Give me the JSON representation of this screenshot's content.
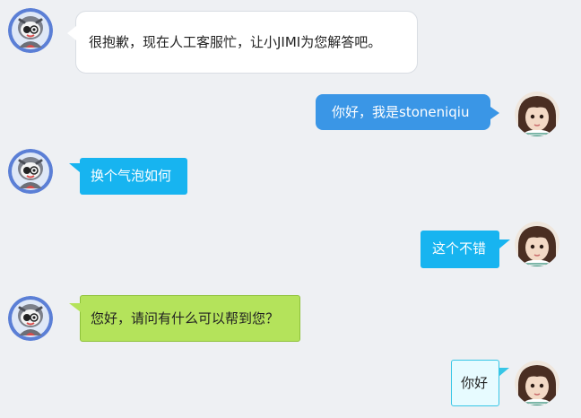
{
  "messages": [
    {
      "sender": "bot",
      "text": "很抱歉，现在人工客服忙，让小JIMI为您解答吧。",
      "bubble_color": "#ffffff"
    },
    {
      "sender": "user",
      "text": "你好，我是stoneniqiu",
      "bubble_color": "#3a96e6"
    },
    {
      "sender": "bot",
      "text": "换个气泡如何",
      "bubble_color": "#17b4f0"
    },
    {
      "sender": "user",
      "text": "这个不错",
      "bubble_color": "#17b4f0"
    },
    {
      "sender": "bot",
      "text": "您好，请问有什么可以帮到您？",
      "bubble_color": "#b4e35b"
    },
    {
      "sender": "user",
      "text": "你好",
      "bubble_color": "#e7fbff"
    }
  ],
  "icons": {
    "bot_avatar": "robot-mascot-avatar-icon",
    "user_avatar": "user-photo-avatar-icon"
  },
  "colors": {
    "background": "#eef0f3"
  }
}
